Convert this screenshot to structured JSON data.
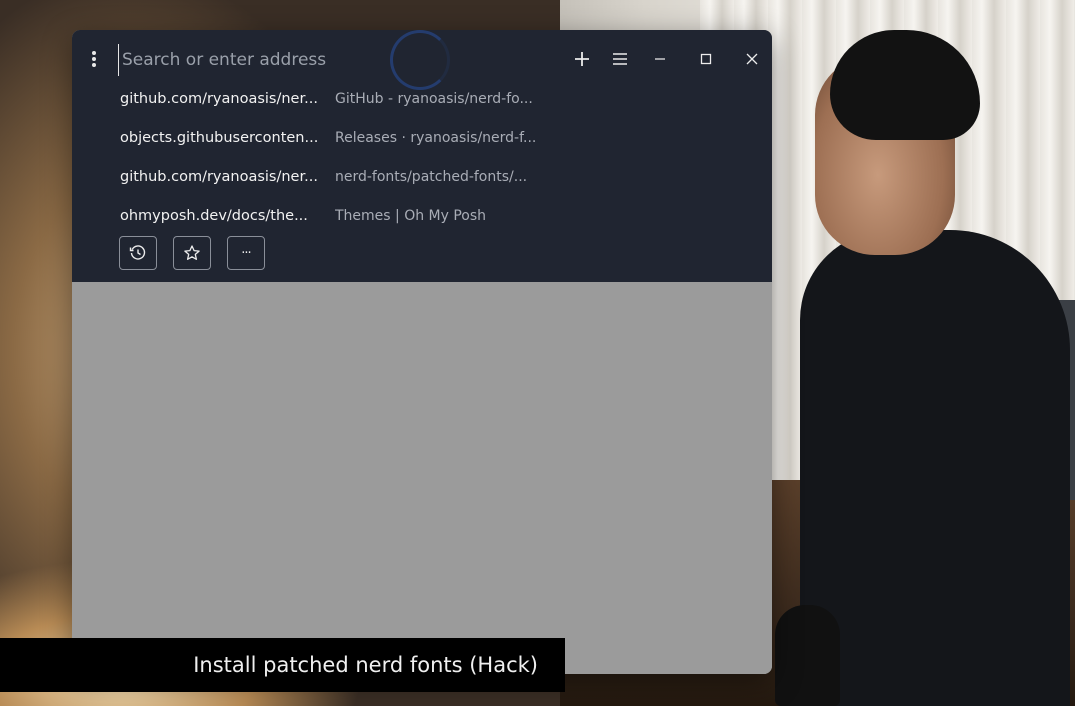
{
  "browser": {
    "address_placeholder": "Search or enter address",
    "icons": {
      "menu": "vertical-dots-icon",
      "new_tab": "plus-icon",
      "tabs": "hamburger-icon",
      "minimize": "minimize-icon",
      "maximize": "maximize-icon",
      "close": "close-icon",
      "history": "history-icon",
      "bookmarks": "star-icon",
      "more": "ellipsis-icon"
    },
    "suggestions": [
      {
        "url": "github.com/ryanoasis/ner...",
        "title": "GitHub - ryanoasis/nerd-fo..."
      },
      {
        "url": "objects.githubuserconten...",
        "title": "Releases · ryanoasis/nerd-f..."
      },
      {
        "url": "github.com/ryanoasis/ner...",
        "title": "nerd-fonts/patched-fonts/..."
      },
      {
        "url": "ohmyposh.dev/docs/the...",
        "title": "Themes | Oh My Posh"
      }
    ],
    "more_label": "···"
  },
  "caption": {
    "text": "Install patched nerd fonts (Hack)"
  },
  "colors": {
    "dropdown_bg": "#202531",
    "content_bg": "#9b9b9b",
    "caption_bg": "#000000"
  }
}
